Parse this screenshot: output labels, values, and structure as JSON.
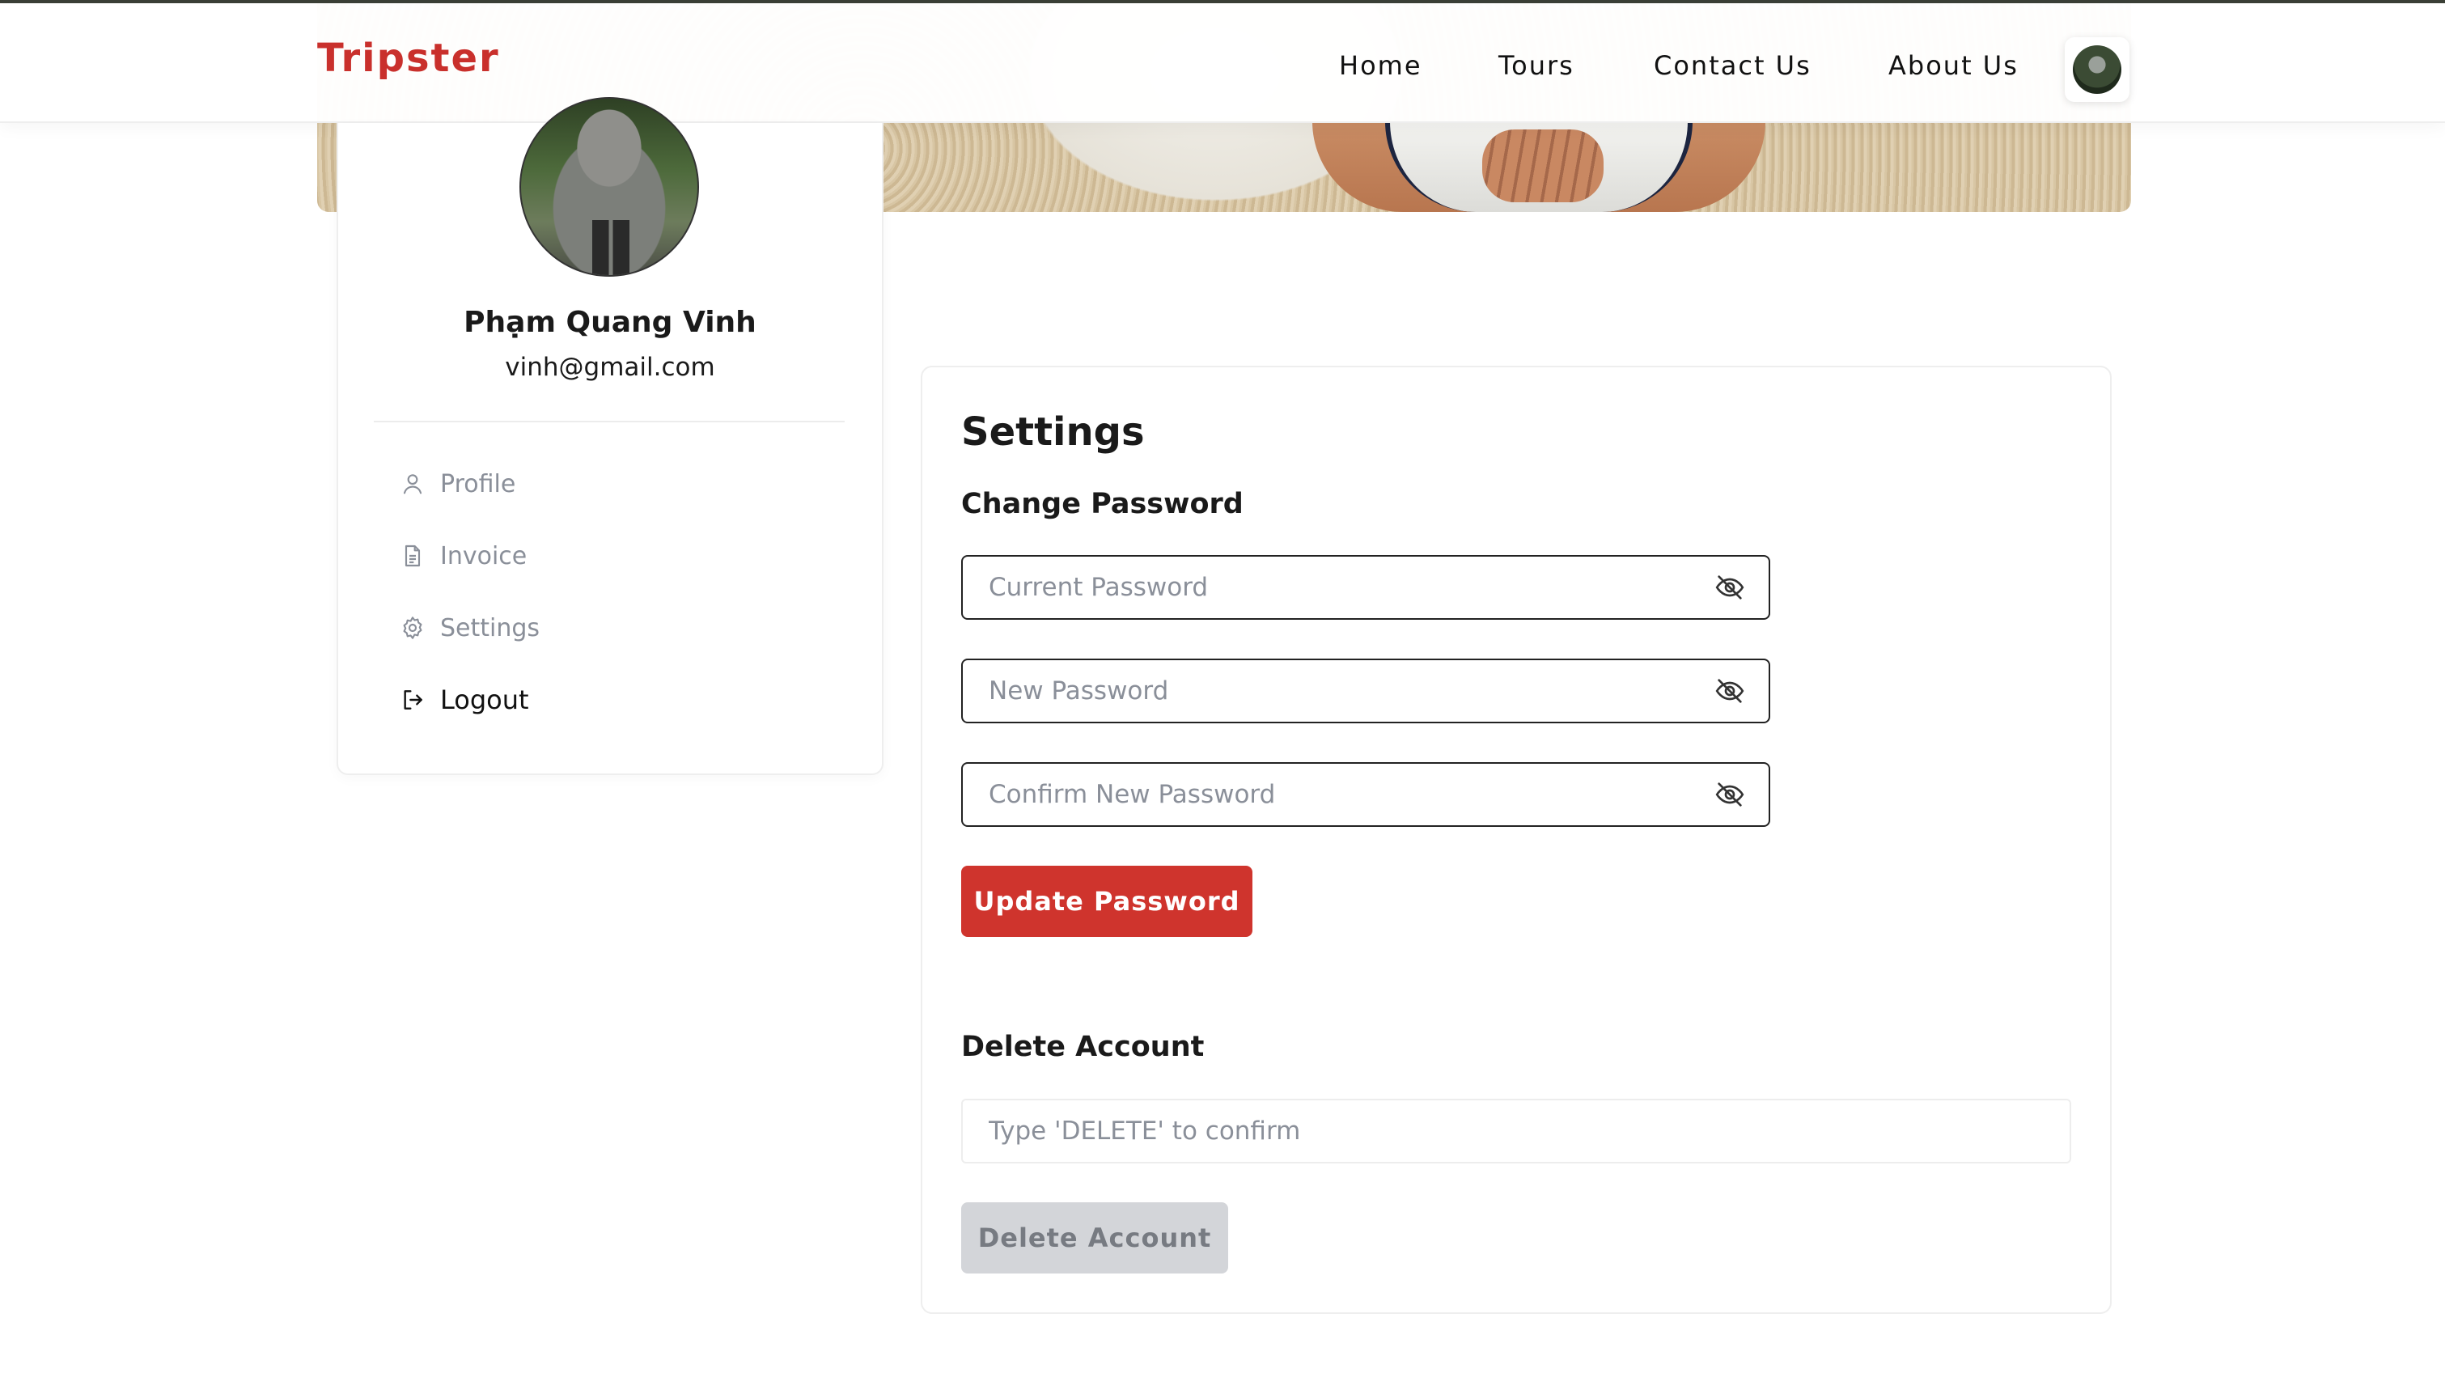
{
  "app": {
    "brand": "Tripster",
    "brand_color": "#c9302c"
  },
  "nav": {
    "items": [
      {
        "label": "Home"
      },
      {
        "label": "Tours"
      },
      {
        "label": "Contact Us"
      },
      {
        "label": "About Us"
      }
    ],
    "avatar_icon": "user-avatar"
  },
  "hero": {
    "image": "beach-sand-person-hat"
  },
  "profile": {
    "name": "Phạm Quang Vinh",
    "email": "vinh@gmail.com",
    "photo": "profile-photo"
  },
  "sidebar": {
    "items": [
      {
        "label": "Profile",
        "icon": "user-icon"
      },
      {
        "label": "Invoice",
        "icon": "document-icon"
      },
      {
        "label": "Settings",
        "icon": "gear-icon"
      },
      {
        "label": "Logout",
        "icon": "logout-icon"
      }
    ]
  },
  "settings": {
    "title": "Settings",
    "change_password": {
      "title": "Change Password",
      "current_placeholder": "Current Password",
      "new_placeholder": "New Password",
      "confirm_placeholder": "Confirm New Password",
      "toggle_icon": "eye-off-icon",
      "button_label": "Update Password",
      "button_color": "#cf342d"
    },
    "delete_account": {
      "title": "Delete Account",
      "placeholder": "Type 'DELETE' to confirm",
      "button_label": "Delete Account",
      "button_state": "disabled"
    }
  }
}
